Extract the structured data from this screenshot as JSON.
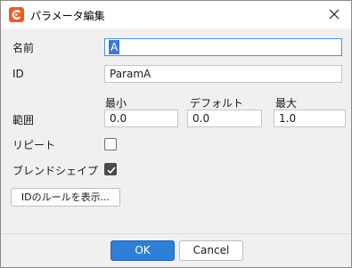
{
  "window": {
    "title": "パラメータ編集"
  },
  "form": {
    "name": {
      "label": "名前",
      "value": "A"
    },
    "id": {
      "label": "ID",
      "value": "ParamA"
    },
    "range": {
      "label": "範囲",
      "min": {
        "header": "最小",
        "value": "0.0"
      },
      "default": {
        "header": "デフォルト",
        "value": "0.0"
      },
      "max": {
        "header": "最大",
        "value": "1.0"
      }
    },
    "repeat": {
      "label": "リピート",
      "checked": false
    },
    "blend_shape": {
      "label": "ブレンドシェイプ",
      "checked": true
    },
    "rules_button_label": "IDのルールを表示..."
  },
  "footer": {
    "ok_label": "OK",
    "cancel_label": "Cancel"
  },
  "colors": {
    "app_icon": "#f05a28",
    "primary_button": "#2f7fd8",
    "focus_border": "#4f8fd9"
  },
  "icons": {
    "app": "app-logo-icon",
    "close": "close-icon",
    "check": "checkmark-icon"
  }
}
